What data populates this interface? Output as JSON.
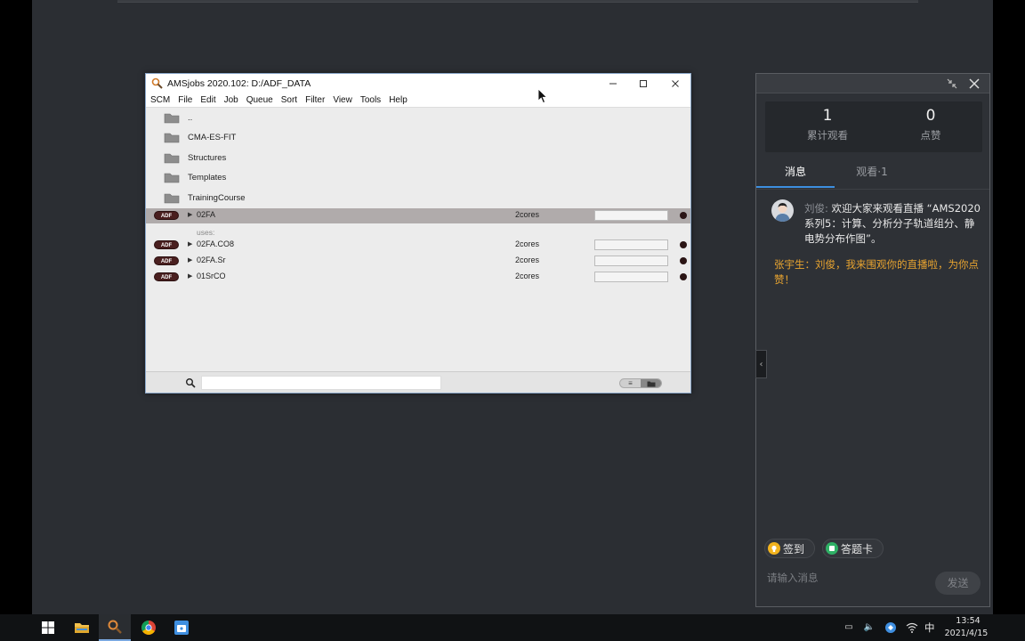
{
  "window": {
    "title": "AMSjobs 2020.102: D:/ADF_DATA",
    "menu": [
      "SCM",
      "File",
      "Edit",
      "Job",
      "Queue",
      "Sort",
      "Filter",
      "View",
      "Tools",
      "Help"
    ],
    "folders": [
      "..",
      "CMA-ES-FIT",
      "Structures",
      "Templates",
      "TrainingCourse"
    ],
    "jobs": [
      {
        "badge": "ADF",
        "name": "02FA",
        "cores": "2cores",
        "selected": true
      },
      {
        "badge": "ADF",
        "name": "02FA.CO8",
        "cores": "2cores"
      },
      {
        "badge": "ADF",
        "name": "02FA.Sr",
        "cores": "2cores"
      },
      {
        "badge": "ADF",
        "name": "01SrCO",
        "cores": "2cores"
      }
    ],
    "uses_label": "uses:",
    "search": {
      "value": ""
    }
  },
  "live": {
    "stats": {
      "views_value": "1",
      "views_label": "累计观看",
      "likes_value": "0",
      "likes_label": "点赞"
    },
    "tabs": {
      "messages": "消息",
      "viewers": "观看·1"
    },
    "messages": [
      {
        "author": "刘俊:",
        "text": "欢迎大家来观看直播 “AMS2020系列5：计算、分析分子轨道组分、静电势分布作图”。"
      },
      {
        "author": "",
        "text": "张宇生：刘俊，我来围观你的直播啦，为你点赞！"
      }
    ],
    "signin_label": "签到",
    "quiz_label": "答题卡",
    "input_placeholder": "请输入消息",
    "send_label": "发送"
  },
  "taskbar": {
    "ime": "中",
    "time": "13:54",
    "date": "2021/4/15"
  },
  "colors": {
    "accent_tab": "#3d8fe0",
    "highlight_message": "#e8a430",
    "adf_badge": "#4a1f1f"
  }
}
